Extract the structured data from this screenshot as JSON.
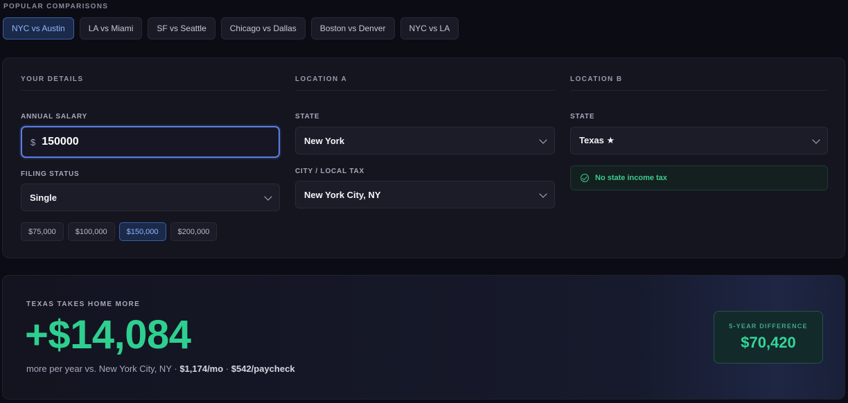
{
  "popular": {
    "label": "POPULAR COMPARISONS",
    "chips": [
      "NYC vs Austin",
      "LA vs Miami",
      "SF vs Seattle",
      "Chicago vs Dallas",
      "Boston vs Denver",
      "NYC vs LA"
    ],
    "active_index": 0
  },
  "details": {
    "header": "YOUR DETAILS",
    "salary_label": "ANNUAL SALARY",
    "currency_symbol": "$",
    "salary_value": "150000",
    "filing_label": "FILING STATUS",
    "filing_value": "Single",
    "presets": [
      "$75,000",
      "$100,000",
      "$150,000",
      "$200,000"
    ],
    "active_preset": 2
  },
  "location_a": {
    "header": "LOCATION A",
    "state_label": "STATE",
    "state_value": "New York",
    "city_label": "CITY / LOCAL TAX",
    "city_value": "New York City, NY"
  },
  "location_b": {
    "header": "LOCATION B",
    "state_label": "STATE",
    "state_value": "Texas ★",
    "notice": "No state income tax"
  },
  "result": {
    "headline": "TEXAS TAKES HOME MORE",
    "amount": "+$14,084",
    "sub_prefix": "more per year vs. New York City, NY · ",
    "monthly": "$1,174/mo",
    "separator": " · ",
    "paycheck": "$542/paycheck",
    "five_year_label": "5-YEAR DIFFERENCE",
    "five_year_value": "$70,420"
  },
  "colors": {
    "accent_blue": "#5a7fe0",
    "positive_green": "#2ecf8f",
    "background": "#0c0c14"
  }
}
